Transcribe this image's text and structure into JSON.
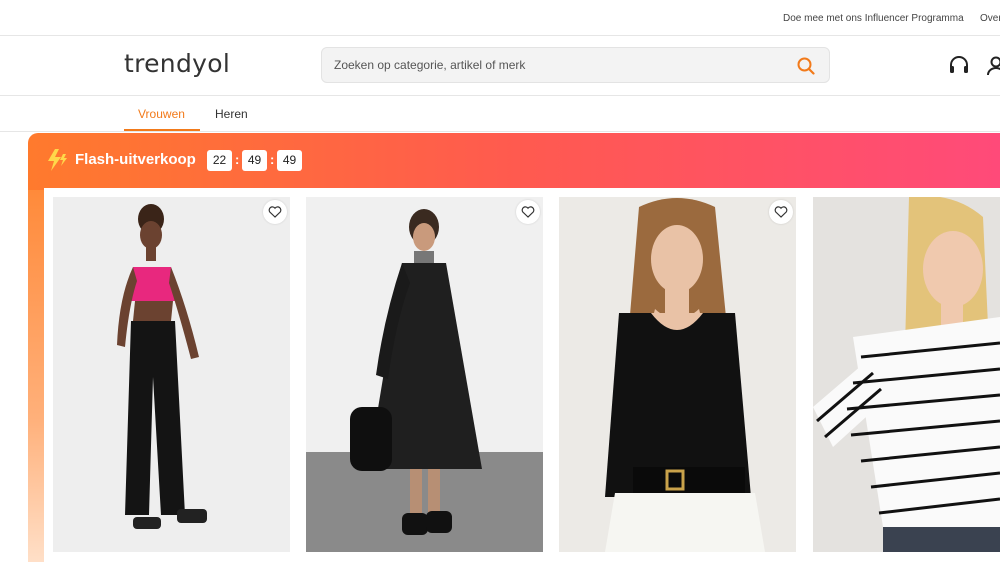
{
  "topbar": {
    "influencer_link": "Doe mee met ons Influencer Programma",
    "over_link": "Over"
  },
  "header": {
    "logo": "trendyol",
    "search_placeholder": "Zoeken op categorie, artikel of merk",
    "icons": [
      "search-icon",
      "headset-icon",
      "user-icon"
    ]
  },
  "nav": {
    "tabs": [
      {
        "label": "Vrouwen",
        "active": true
      },
      {
        "label": "Heren",
        "active": false
      }
    ]
  },
  "flash_sale": {
    "title": "Flash-uitverkoop",
    "timer": {
      "hours": "22",
      "minutes": "49",
      "seconds": "49",
      "separator": ":"
    },
    "products": [
      {
        "image": "model-pink-halter-top-black-jeans",
        "favorite_icon": "heart-icon"
      },
      {
        "image": "model-black-long-coat-backpack",
        "favorite_icon": "heart-icon"
      },
      {
        "image": "model-black-ribbed-top-white-trousers",
        "favorite_icon": "heart-icon"
      },
      {
        "image": "model-white-striped-sweater"
      }
    ]
  },
  "colors": {
    "accent": "#f27a1a",
    "flash_gradient_start": "#ff7a2d",
    "flash_gradient_end": "#ff4a7a"
  }
}
